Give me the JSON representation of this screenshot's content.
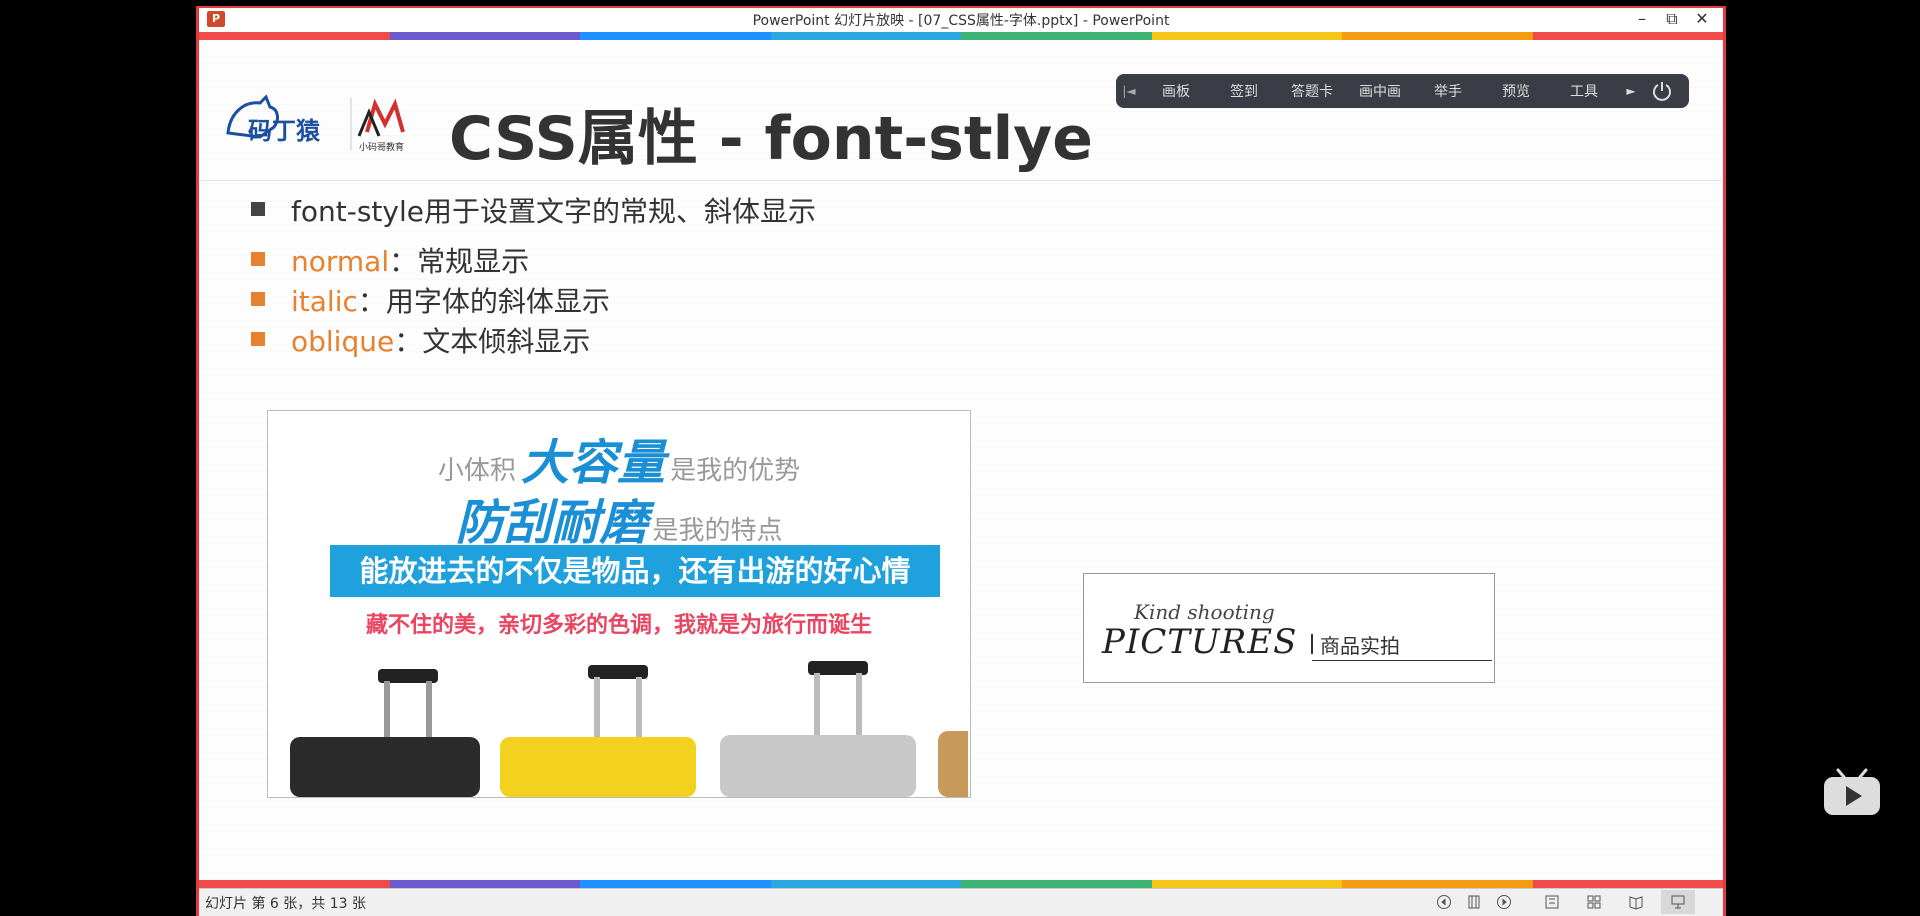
{
  "window": {
    "title": "PowerPoint 幻灯片放映 - [07_CSS属性-字体.pptx] - PowerPoint",
    "app_icon": "P",
    "controls": [
      "–",
      "⧉",
      "✕"
    ]
  },
  "rainbow_colors": [
    "#ef4b4b",
    "#6a5acd",
    "#1e90ff",
    "#2aa9e0",
    "#3cb371",
    "#f5c518",
    "#f39c12",
    "#ef4b4b"
  ],
  "slide": {
    "title": "CSS属性 - font-stlye",
    "logo1_text": "码丁猿",
    "logo2_text": "小码哥教育",
    "bullets": [
      {
        "keyword": "",
        "text": "font-style用于设置文字的常规、斜体显示",
        "square_color": "#444444"
      },
      {
        "keyword": "normal",
        "text": "：常规显示",
        "square_color": "#e8812e"
      },
      {
        "keyword": "italic",
        "text": "：用字体的斜体显示",
        "square_color": "#e8812e"
      },
      {
        "keyword": "oblique",
        "text": "：文本倾斜显示",
        "square_color": "#e8812e"
      }
    ],
    "product_image": {
      "line1_small_a": "小体积",
      "line1_big": "大容量",
      "line1_small_b": "是我的优势",
      "line2_big": "防刮耐磨",
      "line2_small": "是我的特点",
      "banner": "能放进去的不仅是物品，还有出游的好心情",
      "red_text": "藏不住的美，亲切多彩的色调，我就是为旅行而诞生",
      "suitcase_colors": [
        "#2b2b2b",
        "#f2d21e",
        "#c8c8c8",
        "#c89a5a"
      ]
    },
    "kind_image": {
      "script": "Kind shooting",
      "pictures": "PICTURES",
      "cn": "商品实拍"
    }
  },
  "toolbar": {
    "items": [
      "画板",
      "签到",
      "答题卡",
      "画中画",
      "举手",
      "预览",
      "工具"
    ],
    "handle": "|◄",
    "arrow": "►"
  },
  "statusbar": {
    "text": "幻灯片 第 6 张，共 13 张",
    "icons": [
      "prev-icon",
      "pause-icon",
      "next-icon",
      "normal-view-icon",
      "slide-sorter-icon",
      "reading-view-icon",
      "slideshow-icon"
    ]
  }
}
